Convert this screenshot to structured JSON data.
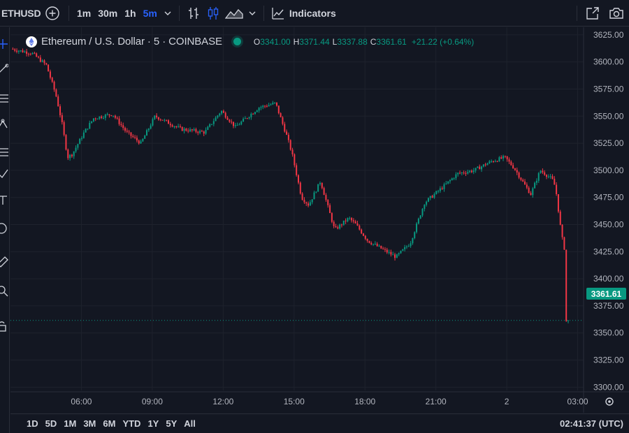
{
  "toolbar": {
    "symbol": "ETHUSD",
    "intervals": [
      "1m",
      "30m",
      "1h",
      "5m"
    ],
    "active_interval": "5m",
    "indicators_label": "Indicators"
  },
  "legend": {
    "title": "Ethereum / U.S. Dollar · 5 · COINBASE",
    "open_label": "O",
    "open": "3341.00",
    "high_label": "H",
    "high": "3371.44",
    "low_label": "L",
    "low": "3337.88",
    "close_label": "C",
    "close": "3361.61",
    "change": "+21.22 (+0.64%)"
  },
  "price_axis": {
    "ticks": [
      "3625.00",
      "3600.00",
      "3575.00",
      "3550.00",
      "3525.00",
      "3500.00",
      "3475.00",
      "3450.00",
      "3425.00",
      "3400.00",
      "3375.00",
      "3350.00",
      "3325.00",
      "3300.00"
    ],
    "current_price": "3361.61"
  },
  "time_axis": {
    "ticks": [
      "06:00",
      "09:00",
      "12:00",
      "15:00",
      "18:00",
      "21:00",
      "2",
      "03:00"
    ]
  },
  "bottom_bar": {
    "ranges": [
      "1D",
      "5D",
      "1M",
      "3M",
      "6M",
      "YTD",
      "1Y",
      "5Y",
      "All"
    ],
    "clock": "02:41:37 (UTC)"
  },
  "colors": {
    "up": "#089981",
    "down": "#f23645",
    "accent": "#2962ff",
    "bg": "#131722",
    "grid": "#1e222d"
  },
  "chart_data": {
    "type": "candlestick",
    "ylim": [
      3297,
      3632
    ],
    "y_ticks": [
      3625,
      3600,
      3575,
      3550,
      3525,
      3500,
      3475,
      3450,
      3425,
      3400,
      3375,
      3350,
      3325,
      3300
    ],
    "x_range_hours": [
      3.0,
      27.25
    ],
    "x_ticks": [
      {
        "label": "06:00",
        "h": 6
      },
      {
        "label": "09:00",
        "h": 9
      },
      {
        "label": "12:00",
        "h": 12
      },
      {
        "label": "15:00",
        "h": 15
      },
      {
        "label": "18:00",
        "h": 18
      },
      {
        "label": "21:00",
        "h": 21
      },
      {
        "label": "2",
        "h": 24
      },
      {
        "label": "03:00",
        "h": 27
      }
    ],
    "last_price": 3361.61,
    "path_hours": [
      3.1,
      4.0,
      4.6,
      5.0,
      5.25,
      5.5,
      5.7,
      6.2,
      6.6,
      7.4,
      8.0,
      8.6,
      9.2,
      10.3,
      11.3,
      12.0,
      12.6,
      13.6,
      14.3,
      14.8,
      15.0,
      15.4,
      15.7,
      16.2,
      16.8,
      17.4,
      17.7,
      18.2,
      18.6,
      19.4,
      20.0,
      20.6,
      21.4,
      22.0,
      22.7,
      23.4,
      24.0,
      24.4,
      24.8,
      25.1,
      25.5,
      26.0,
      26.15,
      26.4,
      26.55,
      26.6
    ],
    "path_prices": [
      3612,
      3608,
      3597,
      3570,
      3545,
      3512,
      3515,
      3535,
      3548,
      3552,
      3535,
      3525,
      3550,
      3538,
      3535,
      3555,
      3540,
      3558,
      3562,
      3530,
      3515,
      3475,
      3468,
      3490,
      3445,
      3456,
      3450,
      3435,
      3430,
      3420,
      3433,
      3470,
      3485,
      3497,
      3500,
      3508,
      3512,
      3502,
      3488,
      3478,
      3500,
      3492,
      3484,
      3440,
      3425,
      3361
    ]
  }
}
